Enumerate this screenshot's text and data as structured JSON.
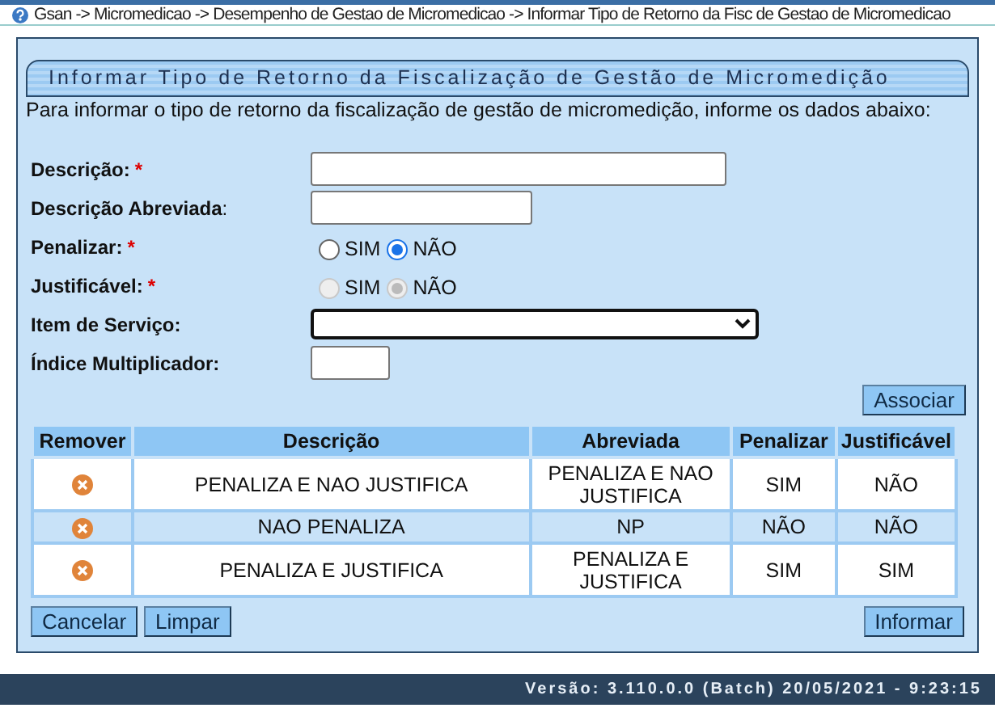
{
  "breadcrumb": "Gsan -> Micromedicao -> Desempenho de Gestao de Micromedicao -> Informar Tipo de Retorno da Fisc de Gestao de Micromedicao",
  "title": "Informar Tipo de Retorno da Fiscalização de Gestão de Micromedição",
  "intro": "Para informar o tipo de retorno da fiscalização de gestão de micromedição, informe os dados abaixo:",
  "fields": [
    {
      "kind": "wide_text",
      "label": "Descrição:",
      "required_mark": "*"
    },
    {
      "kind": "medium_text",
      "label": "Descrição Abreviada",
      "suffix": ":"
    },
    {
      "kind": "radio",
      "label": "Penalizar:",
      "required_mark": "*",
      "disabled": false,
      "options": [
        {
          "label": "SIM",
          "selected": false
        },
        {
          "label": "NÃO",
          "selected": true
        }
      ]
    },
    {
      "kind": "radio",
      "label": "Justificável:",
      "required_mark": "*",
      "disabled": true,
      "options": [
        {
          "label": "SIM",
          "selected": false
        },
        {
          "label": "NÃO",
          "selected": true
        }
      ]
    },
    {
      "kind": "select",
      "label": "Item de Serviço:"
    },
    {
      "kind": "small_text",
      "label": "Índice Multiplicador:"
    }
  ],
  "associate_button": "Associar",
  "table": {
    "columns": [
      "Remover",
      "Descrição",
      "Abreviada",
      "Penalizar",
      "Justificável"
    ],
    "rows": [
      {
        "descricao": "PENALIZA E NAO JUSTIFICA",
        "abreviada": "PENALIZA E NAO JUSTIFICA",
        "penalizar": "SIM",
        "justificavel": "NÃO"
      },
      {
        "descricao": "NAO PENALIZA",
        "abreviada": "NP",
        "penalizar": "NÃO",
        "justificavel": "NÃO"
      },
      {
        "descricao": "PENALIZA E JUSTIFICA",
        "abreviada": "PENALIZA E JUSTIFICA",
        "penalizar": "SIM",
        "justificavel": "SIM"
      }
    ]
  },
  "buttons_left": [
    "Cancelar",
    "Limpar"
  ],
  "button_right": "Informar",
  "version": "Versão: 3.110.0.0 (Batch) 20/05/2021 - 9:23:15"
}
